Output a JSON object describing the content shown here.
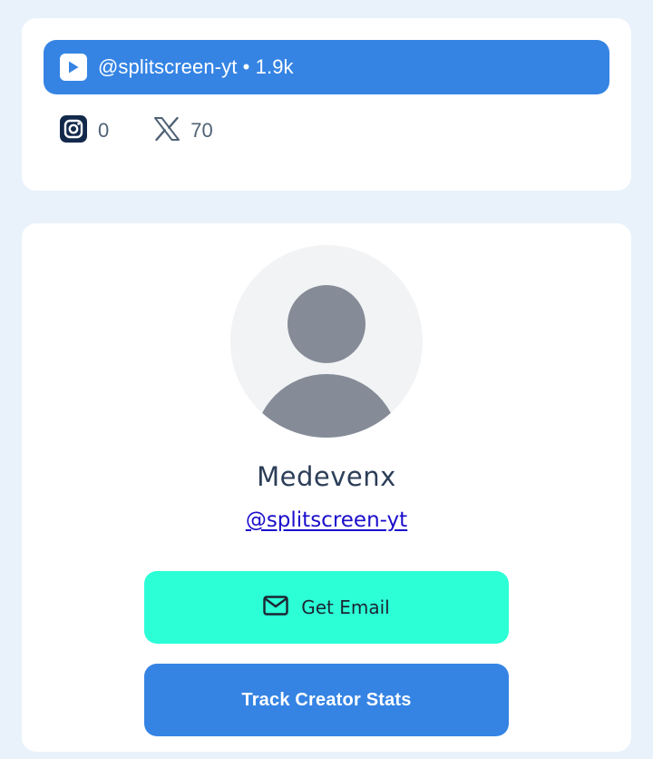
{
  "channels": {
    "youtube": {
      "icon": "youtube-play-icon",
      "text": "@splitscreen-yt • 1.9k"
    },
    "instagram": {
      "icon": "instagram-icon",
      "count": "0"
    },
    "x": {
      "icon": "x-logo-icon",
      "count": "70"
    }
  },
  "profile": {
    "avatar_icon": "default-avatar-icon",
    "name": "Medevenx",
    "handle": "@splitscreen-yt"
  },
  "actions": {
    "email": {
      "icon": "mail-icon",
      "label": "Get Email"
    },
    "track": {
      "label": "Track Creator Stats"
    }
  },
  "colors": {
    "page_background": "#e9f2fb",
    "primary_blue": "#3584e4",
    "email_button": "#2cffd6",
    "name_text": "#2c3e58",
    "count_text": "#4f6275",
    "link": "#1a0dcc"
  }
}
